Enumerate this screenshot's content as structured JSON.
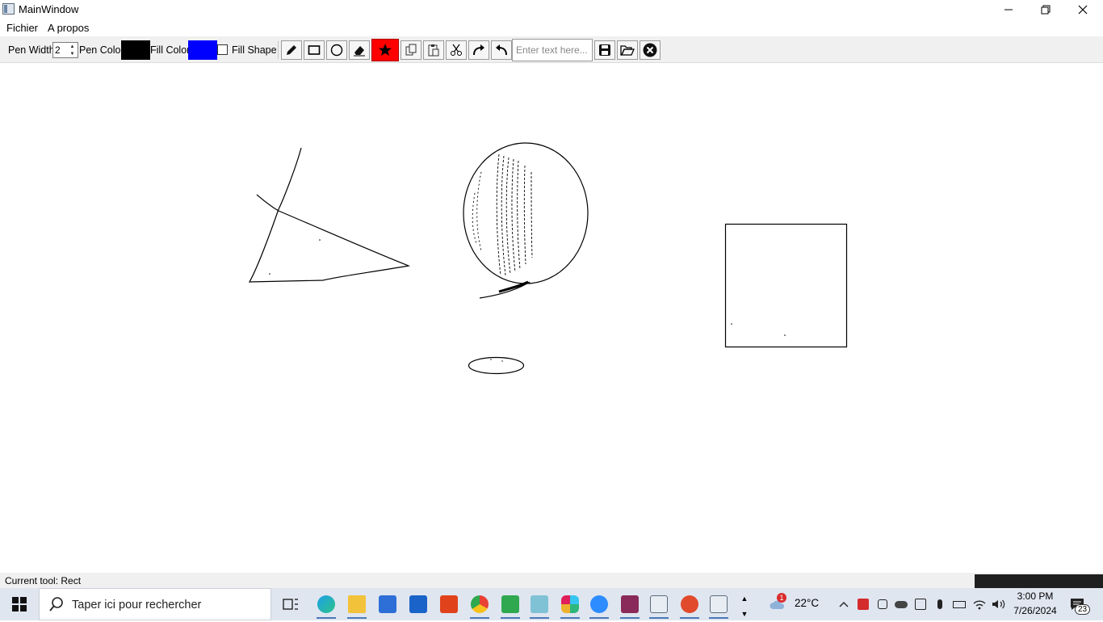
{
  "window": {
    "title": "MainWindow"
  },
  "menu": {
    "items": [
      "Fichier",
      "A propos"
    ]
  },
  "toolbar": {
    "pen_width_label": "Pen Width",
    "pen_width_value": "2",
    "pen_color_label": "Pen Color",
    "pen_color": "#000000",
    "fill_color_label": "Fill Color",
    "fill_color": "#0000ff",
    "fill_shape_label": "Fill Shape",
    "fill_shape_checked": false,
    "text_placeholder": "Enter text here...",
    "active_tool_color": "#ff0000",
    "tools": [
      "pencil-icon",
      "rectangle-icon",
      "circle-icon",
      "eraser-icon",
      "star-icon",
      "copy-icon",
      "paste-icon",
      "cut-icon",
      "redo-icon",
      "undo-icon",
      "save-icon",
      "open-folder-icon",
      "close-circle-icon"
    ]
  },
  "status": {
    "text": "Current tool: Rect"
  },
  "taskbar": {
    "search_placeholder": "Taper ici pour rechercher",
    "weather_temp": "22°C",
    "weather_badge": "1",
    "time": "3:00 PM",
    "date": "7/26/2024",
    "notification_count": "23",
    "apps": [
      "task-view-icon",
      "edge-icon",
      "file-explorer-icon",
      "store-icon",
      "mail-icon",
      "office-icon",
      "chrome-icon",
      "qc-icon",
      "notes-icon",
      "slack-icon",
      "zoom-icon",
      "winrar-icon",
      "window-app-icon",
      "paint-app-icon",
      "mainwindow-app-icon"
    ]
  }
}
